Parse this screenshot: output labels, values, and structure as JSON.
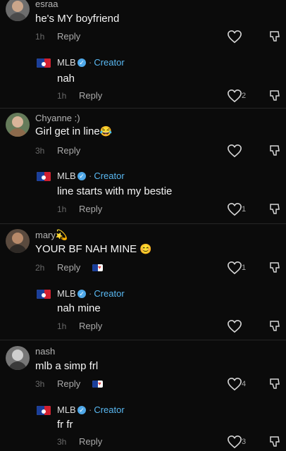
{
  "labels": {
    "reply": "Reply",
    "creator": "Creator",
    "dot": "·"
  },
  "comments": [
    {
      "user": "esraa",
      "text": "he's MY boyfriend",
      "time": "1h",
      "likes": "",
      "reply": {
        "user": "MLB",
        "text": "nah",
        "time": "1h",
        "likes": "2"
      }
    },
    {
      "user": "Chyanne :)",
      "text": "Girl get in line",
      "emoji": "😂",
      "time": "3h",
      "likes": "",
      "reply": {
        "user": "MLB",
        "text": "line starts with my bestie",
        "time": "1h",
        "likes": "1"
      }
    },
    {
      "user": "mary",
      "user_emoji": "💫",
      "text": "YOUR BF NAH MINE",
      "emoji": "😊",
      "time": "2h",
      "likes": "1",
      "reply": {
        "user": "MLB",
        "text": "nah mine",
        "time": "1h",
        "likes": ""
      }
    },
    {
      "user": "nash",
      "text": "mlb a simp frl",
      "time": "3h",
      "likes": "4",
      "reply": {
        "user": "MLB",
        "text": "fr fr",
        "time": "3h",
        "likes": "3"
      }
    }
  ],
  "colors": {
    "background": "#0b0b0b",
    "creator": "#59b8f2",
    "verified": "#4fa8e8"
  },
  "icons": [
    "heart-icon",
    "dislike-icon",
    "verified-icon",
    "mlb-logo",
    "creator-liked-badge"
  ]
}
